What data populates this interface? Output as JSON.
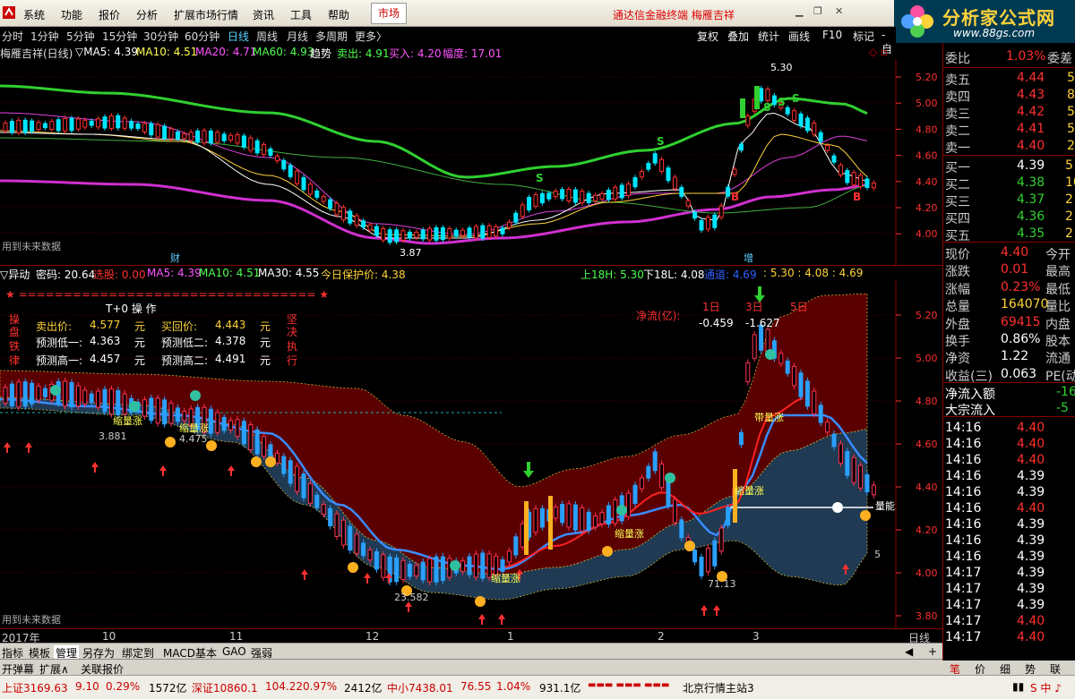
{
  "menu": {
    "items": [
      "系统",
      "功能",
      "报价",
      "分析",
      "扩展市场行情",
      "资讯",
      "工具",
      "帮助"
    ],
    "market": "市场",
    "title": "通达信金融终端  梅雁吉祥"
  },
  "brand": {
    "name": "分析家公式网",
    "url": "www.88gs.com"
  },
  "toolbar": {
    "periods": [
      "分时",
      "1分钟",
      "5分钟",
      "15分钟",
      "30分钟",
      "60分钟",
      "日线",
      "周线",
      "月线",
      "多周期",
      "更多〉"
    ],
    "tools": [
      "复权",
      "叠加",
      "统计",
      "画线",
      "F10",
      "标记",
      "-自"
    ]
  },
  "kline": {
    "name": "梅雁吉祥(日线)",
    "ind": "▽MA5: 4.39",
    "ma10": "MA10: 4.51",
    "ma20": "MA20: 4.71",
    "ma60": "MA60: 4.93",
    "trend": "趋势",
    "sell": "卖出: 4.91",
    "buy": "买入: 4.20",
    "amp": "幅度: 17.01",
    "future": "用到未来数据",
    "cai": "财",
    "zeng": "增",
    "high_label": "5.30",
    "low_label": "3.87",
    "s": "S",
    "b": "B",
    "yticks": [
      "5.20",
      "5.00",
      "4.80",
      "4.60",
      "4.40",
      "4.20",
      "4.00"
    ]
  },
  "t0": {
    "ind": "▽异动",
    "mima": "密码: 20.64",
    "xuangu": "选股: 0.00",
    "ma5": "MA5: 4.39",
    "ma10": "MA10: 4.51",
    "ma30": "MA30: 4.55",
    "protect": "今日保护价: 4.38",
    "up18": "上18H: 5.30",
    "down18": "下18L: 4.08",
    "tongdao": "通道: 4.69",
    "vals": ": 5.30  : 4.08  : 4.69",
    "panel_title": "T+0 操 作",
    "stars": "★ ================================= ★",
    "left_chars": [
      "操",
      "盘",
      "铁",
      "律"
    ],
    "right_chars": [
      "坚",
      "决",
      "执",
      "行"
    ],
    "rows": [
      [
        "卖出价:",
        "4.577",
        "元",
        "买回价:",
        "4.443",
        "元"
      ],
      [
        "预测低一:",
        "4.363",
        "元",
        "预测低二:",
        "4.378",
        "元"
      ],
      [
        "预测高一:",
        "4.457",
        "元",
        "预测高二:",
        "4.491",
        "元"
      ]
    ],
    "flow_title": "净流(亿):",
    "days": [
      "1日",
      "3日",
      "5日"
    ],
    "flows": [
      "-0.459",
      "-1.627"
    ],
    "labels": {
      "suo1": "缩量涨",
      "suo2": "缩量涨",
      "suo3": "缩量涨",
      "suo4": "缩量涨",
      "suo5": "缩量涨",
      "dai": "带量涨",
      "liangneng": "量能",
      "v1": "3.881",
      "v2": "4.475",
      "v3": "23.582",
      "v4": "71.13",
      "v5": "5"
    },
    "future": "用到未来数据",
    "yticks": [
      "5.20",
      "5.00",
      "4.80",
      "4.60",
      "4.40",
      "4.20",
      "4.00",
      "3.80"
    ]
  },
  "xaxis": {
    "labels": [
      "2017年",
      "10",
      "11",
      "12",
      "1",
      "2",
      "3"
    ],
    "period": "日线"
  },
  "tabs1": [
    "指标",
    "模板",
    "管理",
    "另存为",
    "绑定到",
    "MACD基本",
    "GAO",
    "强弱"
  ],
  "tabs2": [
    "开弹幕",
    "扩展∧",
    "关联报价"
  ],
  "quote": {
    "weibi": [
      "委比",
      "1.03%",
      "委差"
    ],
    "sells": [
      [
        "卖五",
        "4.44",
        "5"
      ],
      [
        "卖四",
        "4.43",
        "8"
      ],
      [
        "卖三",
        "4.42",
        "5"
      ],
      [
        "卖二",
        "4.41",
        "5"
      ],
      [
        "卖一",
        "4.40",
        "2"
      ]
    ],
    "buys": [
      [
        "买一",
        "4.39",
        "5"
      ],
      [
        "买二",
        "4.38",
        "10"
      ],
      [
        "买三",
        "4.37",
        "2"
      ],
      [
        "买四",
        "4.36",
        "2"
      ],
      [
        "买五",
        "4.35",
        "2"
      ]
    ],
    "stats": [
      [
        "现价",
        "4.40",
        "今开"
      ],
      [
        "涨跌",
        "0.01",
        "最高"
      ],
      [
        "涨幅",
        "0.23%",
        "最低"
      ],
      [
        "总量",
        "164070",
        "量比"
      ],
      [
        "外盘",
        "69415",
        "内盘"
      ],
      [
        "换手",
        "0.86%",
        "股本"
      ],
      [
        "净资",
        "1.22",
        "流通"
      ],
      [
        "收益(三)",
        "0.063",
        "PE(动"
      ]
    ],
    "flow": [
      [
        "净流入额",
        "-16"
      ],
      [
        "大宗流入",
        "-5"
      ]
    ],
    "ticks": [
      [
        "14:16",
        "4.40"
      ],
      [
        "14:16",
        "4.40"
      ],
      [
        "14:16",
        "4.40"
      ],
      [
        "14:16",
        "4.39"
      ],
      [
        "14:16",
        "4.39"
      ],
      [
        "14:16",
        "4.40"
      ],
      [
        "14:16",
        "4.39"
      ],
      [
        "14:16",
        "4.39"
      ],
      [
        "14:16",
        "4.39"
      ],
      [
        "14:17",
        "4.39"
      ],
      [
        "14:17",
        "4.39"
      ],
      [
        "14:17",
        "4.39"
      ],
      [
        "14:17",
        "4.40"
      ],
      [
        "14:17",
        "4.40"
      ]
    ],
    "tabs": [
      "笔",
      "价",
      "细",
      "势",
      "联"
    ]
  },
  "status": {
    "sh": "上证3169.63",
    "sh_chg": "9.10",
    "sh_pct": "0.29%",
    "sh_vol": "1572亿",
    "sz": "深证10860.1",
    "sz_chg": "104.22",
    "sz_pct": "0.97%",
    "sz_vol": "2412亿",
    "zx": "中小7438.01",
    "zx_chg": "76.55",
    "zx_pct": "1.04%",
    "zx_vol": "931.1亿",
    "server": "北京行情主站3"
  }
}
